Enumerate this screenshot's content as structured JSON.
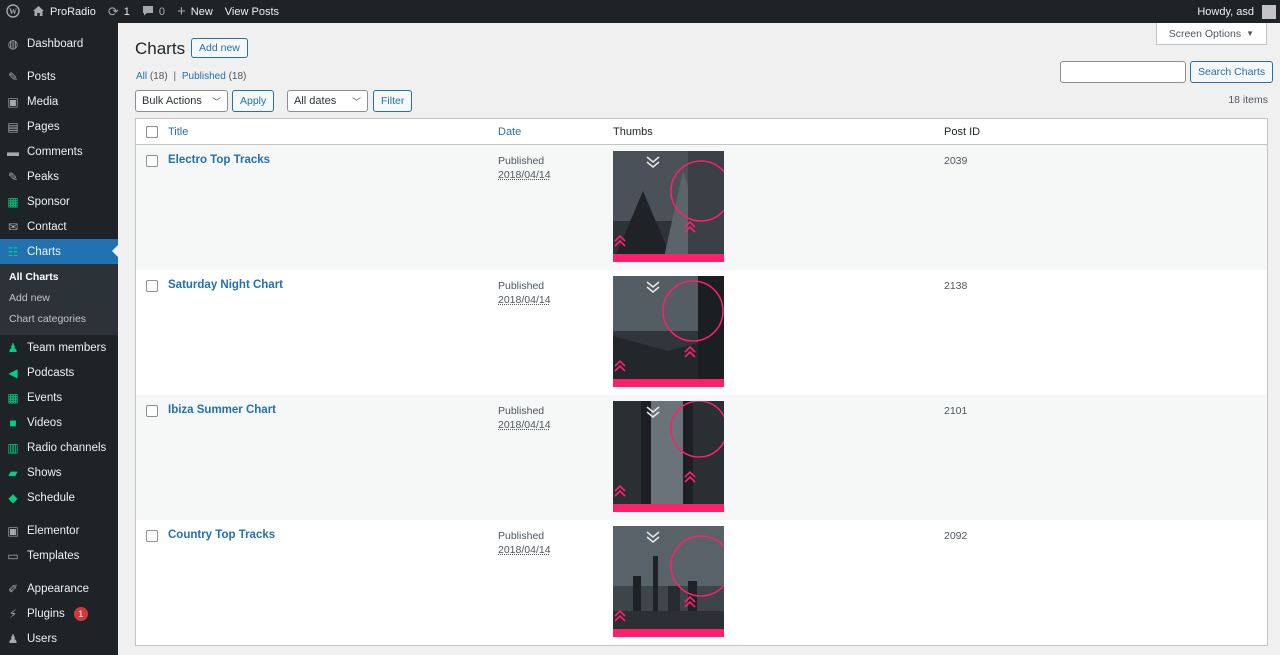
{
  "adminbar": {
    "site_name": "ProRadio",
    "updates_count": "1",
    "comments_count": "0",
    "new_label": "New",
    "view_posts_label": "View Posts",
    "howdy": "Howdy, asd"
  },
  "sidebar": {
    "items": [
      {
        "label": "Dashboard",
        "icon": "dashboard-icon"
      },
      {
        "label": "Posts",
        "icon": "pin-icon"
      },
      {
        "label": "Media",
        "icon": "media-icon"
      },
      {
        "label": "Pages",
        "icon": "page-icon"
      },
      {
        "label": "Comments",
        "icon": "comment-icon"
      },
      {
        "label": "Peaks",
        "icon": "pin-icon"
      },
      {
        "label": "Sponsor",
        "icon": "grid-icon"
      },
      {
        "label": "Contact",
        "icon": "envelope-icon"
      },
      {
        "label": "Charts",
        "icon": "chart-icon"
      },
      {
        "label": "Team members",
        "icon": "person-icon"
      },
      {
        "label": "Podcasts",
        "icon": "megaphone-icon"
      },
      {
        "label": "Events",
        "icon": "calendar-icon"
      },
      {
        "label": "Videos",
        "icon": "video-icon"
      },
      {
        "label": "Radio channels",
        "icon": "radio-icon"
      },
      {
        "label": "Shows",
        "icon": "shows-icon"
      },
      {
        "label": "Schedule",
        "icon": "schedule-icon"
      },
      {
        "label": "Elementor",
        "icon": "elementor-icon"
      },
      {
        "label": "Templates",
        "icon": "folder-icon"
      },
      {
        "label": "Appearance",
        "icon": "brush-icon"
      },
      {
        "label": "Plugins",
        "icon": "plug-icon",
        "badge": "1"
      },
      {
        "label": "Users",
        "icon": "users-icon"
      }
    ],
    "submenu": [
      "All Charts",
      "Add new",
      "Chart categories"
    ]
  },
  "page": {
    "title": "Charts",
    "add_new": "Add new",
    "screen_options": "Screen Options",
    "filter_all": "All",
    "filter_all_count": "(18)",
    "filter_sep": "|",
    "filter_published": "Published",
    "filter_published_count": "(18)",
    "search_placeholder": "",
    "search_button": "Search Charts",
    "bulk_actions": "Bulk Actions",
    "apply": "Apply",
    "all_dates": "All dates",
    "filter": "Filter",
    "items_count": "18 items"
  },
  "table": {
    "headers": {
      "title": "Title",
      "date": "Date",
      "thumbs": "Thumbs",
      "post_id": "Post ID"
    },
    "rows": [
      {
        "title": "Electro Top Tracks",
        "status": "Published",
        "date": "2018/04/14",
        "post_id": "2039"
      },
      {
        "title": "Saturday Night Chart",
        "status": "Published",
        "date": "2018/04/14",
        "post_id": "2138"
      },
      {
        "title": "Ibiza Summer Chart",
        "status": "Published",
        "date": "2018/04/14",
        "post_id": "2101"
      },
      {
        "title": "Country Top Tracks",
        "status": "Published",
        "date": "2018/04/14",
        "post_id": "2092"
      }
    ]
  },
  "colors": {
    "accent": "#2271b1",
    "sidebar_bg": "#1d2327",
    "thumb_pink": "#ff1f6a"
  }
}
